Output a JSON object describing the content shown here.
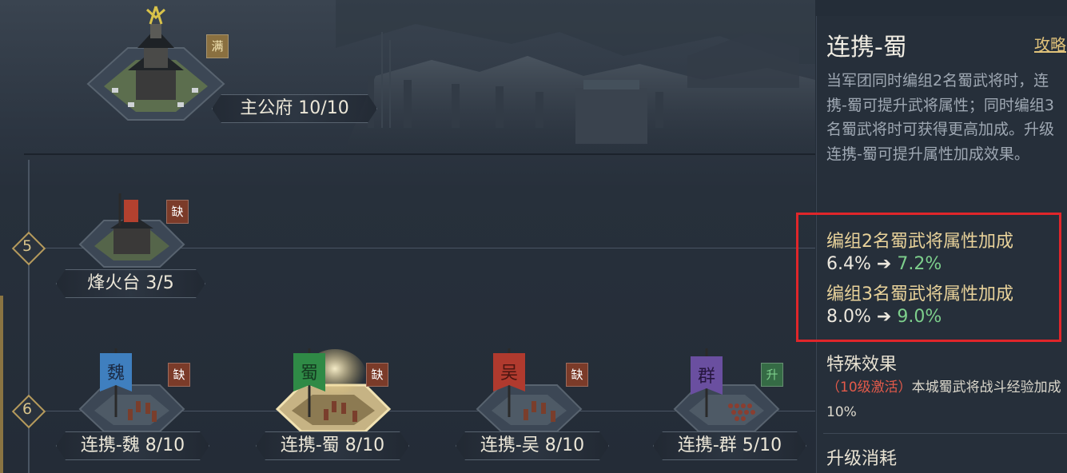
{
  "buildings": {
    "palace": {
      "name": "主公府 10/10",
      "tag": "满"
    },
    "beacon": {
      "name": "烽火台 3/5",
      "tag": "缺"
    },
    "wei": {
      "name": "连携-魏 8/10",
      "tag": "缺",
      "flag_char": "魏",
      "flag_color": "#3f7fbf"
    },
    "shu": {
      "name": "连携-蜀 8/10",
      "tag": "缺",
      "flag_char": "蜀",
      "flag_color": "#2f8a46"
    },
    "wu": {
      "name": "连携-吴 8/10",
      "tag": "缺",
      "flag_char": "吴",
      "flag_color": "#b03a2e"
    },
    "qun": {
      "name": "连携-群 5/10",
      "tag": "升",
      "flag_char": "群",
      "flag_color": "#6a4fa0"
    }
  },
  "rows": {
    "row5": "5",
    "row6": "6"
  },
  "panel": {
    "title": "连携-蜀",
    "guide_link": "攻略",
    "description": "当军团同时编组2名蜀武将时，连携-蜀可提升武将属性；同时编组3名蜀武将时可获得更高加成。升级连携-蜀可提升属性加成效果。",
    "bonus2_label": "编组2名蜀武将属性加成",
    "bonus2_from": "6.4%",
    "bonus2_arrow": "➔",
    "bonus2_to": "7.2%",
    "bonus3_label": "编组3名蜀武将属性加成",
    "bonus3_from": "8.0%",
    "bonus3_arrow": "➔",
    "bonus3_to": "9.0%",
    "special_title": "特殊效果",
    "special_activation": "（10级激活）",
    "special_text": "本城蜀武将战斗经验加成10%",
    "upgrade_cost_title": "升级消耗"
  },
  "colors": {
    "highlight_border": "#e0262a",
    "value_green": "#7dcf8c",
    "label_gold": "#e8d29a",
    "tag_red": "#7b3b29",
    "tag_green": "#356b45"
  }
}
